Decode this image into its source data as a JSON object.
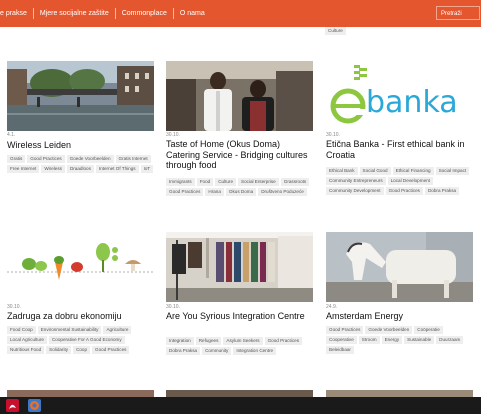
{
  "nav": {
    "items": [
      "e prakse",
      "Mjere socijalne zaštite",
      "Commonplace",
      "O nama"
    ],
    "search_placeholder": "Pretraži"
  },
  "partial_card": {
    "tags": [
      "Culture"
    ]
  },
  "cards": [
    {
      "date": "4.1.",
      "title": "Wireless Leiden",
      "tags": [
        "Gratis",
        "Good Practices",
        "Goede Voorbeelden",
        "Gratis Internet",
        "Free Internet",
        "Wireless",
        "Draadloos",
        "Internet Of Things",
        "IoT"
      ]
    },
    {
      "date": "30.10.",
      "title": "Taste of Home (Okus Doma) Catering Service - Bridging cultures through food",
      "tags": [
        "Immigrants",
        "Food",
        "Culture",
        "Social Enterprise",
        "Grassroots",
        "Good Practices",
        "Hrana",
        "Okus Doma",
        "Društveno Poduzeće"
      ]
    },
    {
      "date": "30.10.",
      "title": "Etična Banka - First ethical bank in Croatia",
      "logo_text": "banka",
      "tags": [
        "Ethical Bank",
        "Social Good",
        "Ethical Financing",
        "Social Impact",
        "Community Entrepreneurs",
        "Local Development",
        "Community Development",
        "Good Practices",
        "Dobra Praksa"
      ]
    },
    {
      "date": "30.10.",
      "title": "Zadruga za dobru ekonomiju",
      "tags": [
        "Food Coop",
        "Environmental Sustainability",
        "Agriculture",
        "Local Agriculture",
        "Cooperative For A Good Economy",
        "Nutritious Food",
        "Solidarity",
        "Coop",
        "Good Practices"
      ]
    },
    {
      "date": "30.10.",
      "title": "Are You Syrious Integration Centre",
      "tags": [
        "Integration",
        "Refugees",
        "Asylum Seekers",
        "Good Practices",
        "Dobra Praksa",
        "Community",
        "Integration Centre"
      ]
    },
    {
      "date": "24.9.",
      "title": "Amsterdam Energy",
      "tags": [
        "Good Practices",
        "Goede Voorbeelden",
        "Coöperatie",
        "Cooperative",
        "Stroom",
        "Energy",
        "Sustainable",
        "Duurzaam",
        "Beleidbaar"
      ]
    }
  ],
  "colors": {
    "topbar": "#e4572e",
    "ebanka_green": "#8dc63f",
    "ebanka_blue": "#2aa8d8"
  }
}
